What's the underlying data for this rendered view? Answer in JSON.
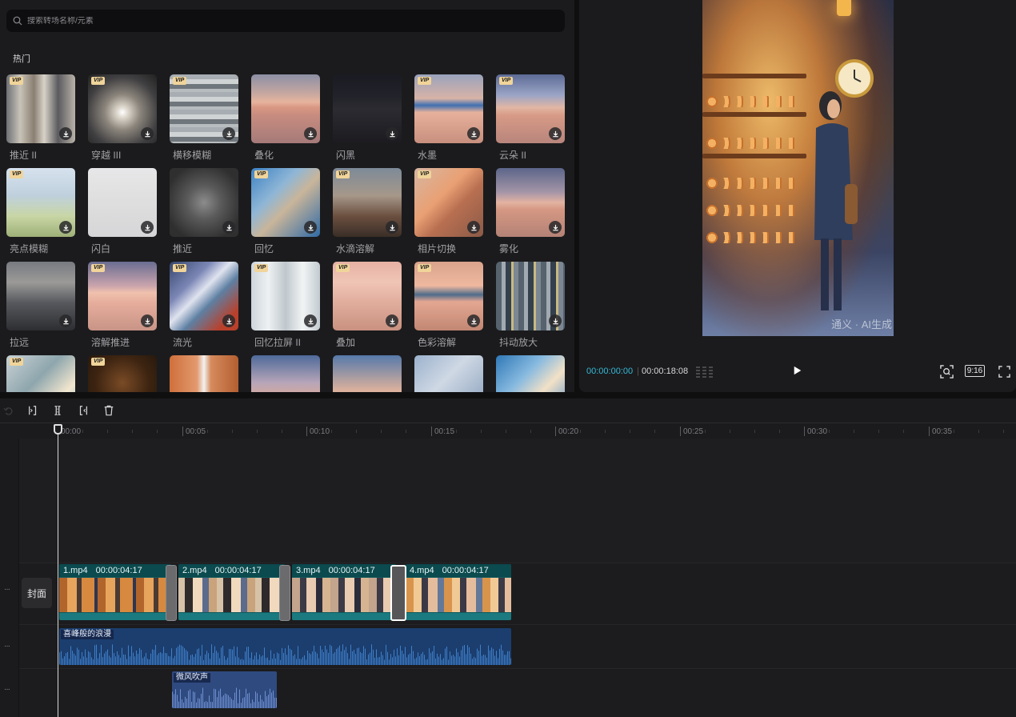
{
  "search": {
    "placeholder": "搜索转场名称/元素"
  },
  "library": {
    "section_title": "热门",
    "vip_label": "VIP",
    "tiles": [
      {
        "label": "推近 II",
        "vip": true
      },
      {
        "label": "穿越 III",
        "vip": true
      },
      {
        "label": "横移模糊",
        "vip": true
      },
      {
        "label": "叠化",
        "vip": false
      },
      {
        "label": "闪黑",
        "vip": false
      },
      {
        "label": "水墨",
        "vip": true
      },
      {
        "label": "云朵 II",
        "vip": true
      },
      {
        "label": "亮点模糊",
        "vip": true
      },
      {
        "label": "闪白",
        "vip": false
      },
      {
        "label": "推近",
        "vip": false
      },
      {
        "label": "回忆",
        "vip": true
      },
      {
        "label": "水滴溶解",
        "vip": true
      },
      {
        "label": "相片切换",
        "vip": true
      },
      {
        "label": "雾化",
        "vip": false
      },
      {
        "label": "拉远",
        "vip": false
      },
      {
        "label": "溶解推进",
        "vip": true
      },
      {
        "label": "流光",
        "vip": true
      },
      {
        "label": "回忆拉屏 II",
        "vip": true
      },
      {
        "label": "叠加",
        "vip": true
      },
      {
        "label": "色彩溶解",
        "vip": true
      },
      {
        "label": "抖动放大",
        "vip": false
      },
      {
        "label": "",
        "vip": true
      },
      {
        "label": "",
        "vip": true
      },
      {
        "label": "",
        "vip": false
      },
      {
        "label": "",
        "vip": false
      },
      {
        "label": "",
        "vip": false
      },
      {
        "label": "",
        "vip": false
      },
      {
        "label": "",
        "vip": false
      }
    ]
  },
  "preview": {
    "watermark": "通义 · AI生成",
    "time_current": "00:00:00:00",
    "time_total": "00:00:18:08",
    "aspect_ratio": "9:16"
  },
  "timeline": {
    "ruler_labels": [
      "00:00",
      "00:05",
      "00:10",
      "00:15",
      "00:20",
      "00:25",
      "00:30",
      "00:35"
    ],
    "cover_label": "封面",
    "track_menu": "···",
    "clips": [
      {
        "name": "1.mp4",
        "duration": "00:00:04:17"
      },
      {
        "name": "2.mp4",
        "duration": "00:00:04:17"
      },
      {
        "name": "3.mp4",
        "duration": "00:00:04:17"
      },
      {
        "name": "4.mp4",
        "duration": "00:00:04:17"
      }
    ],
    "audio_tracks": [
      {
        "name": "喜峰般的浪漫"
      },
      {
        "name": "微风吹声"
      }
    ]
  },
  "colors": {
    "accent_time": "#35b9d6",
    "video_clip": "#0f5a5e",
    "audio_clip": "#1b3e6e"
  }
}
